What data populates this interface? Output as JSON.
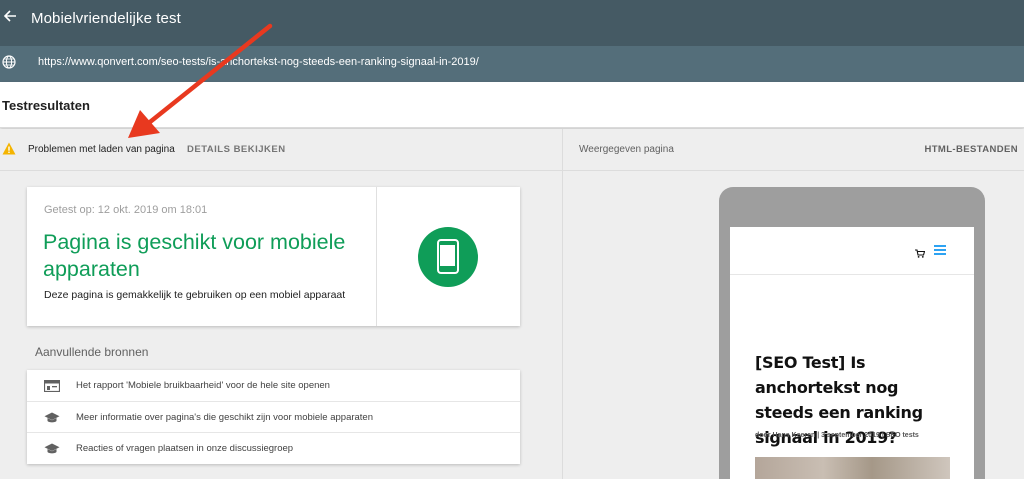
{
  "topbar": {
    "title": "Mobielvriendelijke test"
  },
  "urlbar": {
    "url": "https://www.qonvert.com/seo-tests/is-anchortekst-nog-steeds-een-ranking-signaal-in-2019/"
  },
  "results": {
    "title": "Testresultaten"
  },
  "issue_bar": {
    "message": "Problemen met laden van pagina",
    "details_label": "DETAILS BEKIJKEN",
    "warning_color": "#f4b400"
  },
  "result_card": {
    "tested_on": "Getest op: 12 okt. 2019 om 18:01",
    "heading": "Pagina is geschikt voor mobiele apparaten",
    "subtext": "Deze pagina is gemakkelijk te gebruiken op een mobiel apparaat",
    "accent_color": "#0f9d58",
    "icon": "phone-icon"
  },
  "resources": {
    "title": "Aanvullende bronnen",
    "items": [
      {
        "label": "Het rapport 'Mobiele bruikbaarheid' voor de hele site openen",
        "icon": "report-icon"
      },
      {
        "label": "Meer informatie over pagina's die geschikt zijn voor mobiele apparaten",
        "icon": "school-icon"
      },
      {
        "label": "Reacties of vragen plaatsen in onze discussiegroep",
        "icon": "school-icon"
      }
    ]
  },
  "rendered": {
    "label": "Weergegeven pagina",
    "html_files_label": "HTML-BESTANDEN",
    "post_title": "[SEO Test] Is anchortekst nog steeds een ranking signaal in 2019?",
    "post_meta": "door Hans Keeren | 3 september 2019 | SEO tests"
  },
  "annotation": {
    "arrow_color": "#e8391f"
  }
}
